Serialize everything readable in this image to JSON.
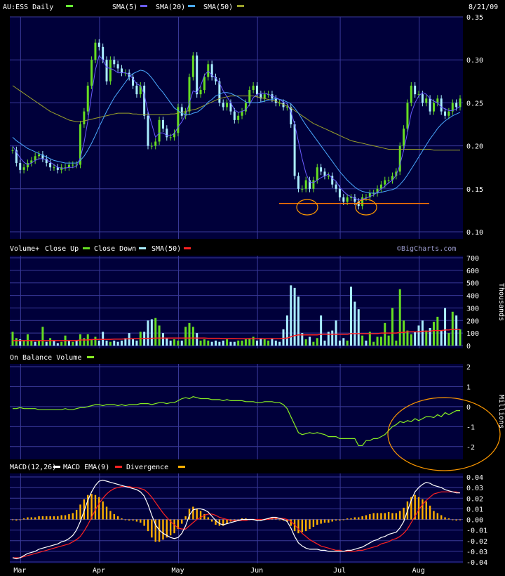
{
  "header": {
    "symbol_label": "AU:ESS Daily",
    "date_label": "8/21/09",
    "legend": [
      {
        "name": "SMA(5)",
        "color": "#6a5cff"
      },
      {
        "name": "SMA(20)",
        "color": "#4aa8ff"
      },
      {
        "name": "SMA(50)",
        "color": "#9aa02a"
      }
    ],
    "symbol_swatch": "#66ff33"
  },
  "volume_header": {
    "label_a": "Volume+",
    "label_b": "Close Up",
    "label_c": "Close Down",
    "label_d": "SMA(50)",
    "watermark": "©BigCharts.com",
    "ylabel": "Thousands"
  },
  "obv_header": {
    "label": "On Balance Volume",
    "ylabel": "Millions"
  },
  "macd_header": {
    "label_a": "MACD(12,26)",
    "label_b": "MACD EMA(9)",
    "label_c": "Divergence"
  },
  "colors": {
    "bg": "#000000",
    "panel": "#00003a",
    "grid": "#3a3a9a",
    "up": "#66dd22",
    "down": "#aaeeff",
    "sma5": "#6a5cff",
    "sma20": "#4aa8ff",
    "sma50": "#9aa02a",
    "volsma": "#ff2222",
    "obv": "#88ee22",
    "macd": "#ffffff",
    "signal": "#ff2222",
    "divergence": "#ffb000",
    "annotation": "#ff7700",
    "circle": "#ff9900"
  },
  "chart_data": [
    {
      "type": "candlestick",
      "title": "AU:ESS Daily",
      "x_month_ticks": [
        "Mar",
        "Apr",
        "May",
        "Jun",
        "Jul",
        "Aug"
      ],
      "ylim": [
        0.1,
        0.35
      ],
      "y_ticks": [
        "0.35",
        "0.30",
        "0.25",
        "0.20",
        "0.15",
        "0.10"
      ],
      "grid": true,
      "support_price": 0.133,
      "close": [
        0.195,
        0.18,
        0.172,
        0.175,
        0.18,
        0.183,
        0.188,
        0.19,
        0.185,
        0.18,
        0.175,
        0.175,
        0.172,
        0.175,
        0.175,
        0.178,
        0.178,
        0.178,
        0.225,
        0.24,
        0.27,
        0.3,
        0.32,
        0.315,
        0.3,
        0.275,
        0.3,
        0.295,
        0.29,
        0.285,
        0.285,
        0.28,
        0.27,
        0.26,
        0.27,
        0.235,
        0.2,
        0.2,
        0.205,
        0.23,
        0.22,
        0.21,
        0.21,
        0.215,
        0.245,
        0.235,
        0.24,
        0.28,
        0.305,
        0.26,
        0.265,
        0.28,
        0.295,
        0.28,
        0.275,
        0.25,
        0.245,
        0.25,
        0.24,
        0.23,
        0.235,
        0.24,
        0.25,
        0.265,
        0.27,
        0.26,
        0.255,
        0.26,
        0.26,
        0.255,
        0.25,
        0.25,
        0.245,
        0.245,
        0.225,
        0.165,
        0.15,
        0.15,
        0.16,
        0.15,
        0.16,
        0.175,
        0.17,
        0.165,
        0.165,
        0.155,
        0.15,
        0.14,
        0.135,
        0.14,
        0.14,
        0.135,
        0.13,
        0.14,
        0.14,
        0.145,
        0.145,
        0.15,
        0.155,
        0.16,
        0.16,
        0.165,
        0.17,
        0.2,
        0.22,
        0.25,
        0.27,
        0.26,
        0.26,
        0.25,
        0.255,
        0.24,
        0.25,
        0.255,
        0.24,
        0.235,
        0.24,
        0.25,
        0.245,
        0.255
      ],
      "sma5": [
        0.2,
        0.193,
        0.186,
        0.181,
        0.178,
        0.18,
        0.183,
        0.185,
        0.185,
        0.184,
        0.181,
        0.178,
        0.175,
        0.174,
        0.174,
        0.175,
        0.175,
        0.176,
        0.186,
        0.204,
        0.229,
        0.26,
        0.288,
        0.305,
        0.3,
        0.291,
        0.29,
        0.288,
        0.285,
        0.285,
        0.285,
        0.283,
        0.278,
        0.272,
        0.27,
        0.26,
        0.24,
        0.225,
        0.21,
        0.215,
        0.215,
        0.212,
        0.212,
        0.214,
        0.222,
        0.228,
        0.236,
        0.25,
        0.264,
        0.262,
        0.27,
        0.282,
        0.287,
        0.282,
        0.279,
        0.273,
        0.264,
        0.257,
        0.25,
        0.242,
        0.239,
        0.24,
        0.242,
        0.248,
        0.256,
        0.26,
        0.261,
        0.261,
        0.26,
        0.258,
        0.256,
        0.254,
        0.251,
        0.249,
        0.24,
        0.225,
        0.205,
        0.185,
        0.168,
        0.158,
        0.157,
        0.16,
        0.163,
        0.165,
        0.167,
        0.162,
        0.159,
        0.152,
        0.147,
        0.143,
        0.141,
        0.139,
        0.137,
        0.138,
        0.139,
        0.141,
        0.143,
        0.146,
        0.15,
        0.153,
        0.157,
        0.16,
        0.166,
        0.178,
        0.195,
        0.215,
        0.238,
        0.25,
        0.258,
        0.262,
        0.26,
        0.255,
        0.252,
        0.25,
        0.245,
        0.243,
        0.241,
        0.241,
        0.243,
        0.246
      ],
      "sma20": [
        0.21,
        0.206,
        0.203,
        0.2,
        0.197,
        0.195,
        0.193,
        0.191,
        0.189,
        0.187,
        0.185,
        0.183,
        0.182,
        0.181,
        0.18,
        0.18,
        0.18,
        0.18,
        0.183,
        0.188,
        0.195,
        0.203,
        0.212,
        0.222,
        0.231,
        0.24,
        0.248,
        0.256,
        0.262,
        0.268,
        0.274,
        0.28,
        0.284,
        0.286,
        0.288,
        0.287,
        0.284,
        0.279,
        0.273,
        0.267,
        0.262,
        0.256,
        0.25,
        0.244,
        0.241,
        0.238,
        0.236,
        0.236,
        0.238,
        0.239,
        0.242,
        0.246,
        0.251,
        0.254,
        0.258,
        0.26,
        0.262,
        0.262,
        0.261,
        0.259,
        0.257,
        0.254,
        0.251,
        0.25,
        0.25,
        0.25,
        0.251,
        0.252,
        0.253,
        0.254,
        0.255,
        0.254,
        0.253,
        0.251,
        0.249,
        0.244,
        0.238,
        0.231,
        0.224,
        0.218,
        0.212,
        0.206,
        0.2,
        0.194,
        0.188,
        0.182,
        0.176,
        0.17,
        0.165,
        0.16,
        0.156,
        0.152,
        0.149,
        0.147,
        0.146,
        0.145,
        0.145,
        0.145,
        0.146,
        0.147,
        0.148,
        0.149,
        0.151,
        0.155,
        0.16,
        0.166,
        0.173,
        0.18,
        0.187,
        0.194,
        0.201,
        0.208,
        0.214,
        0.22,
        0.225,
        0.229,
        0.232,
        0.235,
        0.237,
        0.239
      ],
      "sma50": [
        0.27,
        0.267,
        0.264,
        0.261,
        0.258,
        0.255,
        0.252,
        0.249,
        0.246,
        0.243,
        0.24,
        0.238,
        0.236,
        0.234,
        0.232,
        0.23,
        0.229,
        0.228,
        0.228,
        0.229,
        0.23,
        0.231,
        0.232,
        0.233,
        0.234,
        0.235,
        0.236,
        0.237,
        0.238,
        0.238,
        0.238,
        0.238,
        0.237,
        0.237,
        0.236,
        0.236,
        0.236,
        0.236,
        0.236,
        0.236,
        0.236,
        0.236,
        0.237,
        0.237,
        0.238,
        0.239,
        0.24,
        0.241,
        0.242,
        0.243,
        0.245,
        0.247,
        0.249,
        0.251,
        0.253,
        0.255,
        0.256,
        0.257,
        0.258,
        0.258,
        0.258,
        0.258,
        0.258,
        0.258,
        0.258,
        0.257,
        0.256,
        0.255,
        0.254,
        0.253,
        0.252,
        0.25,
        0.248,
        0.246,
        0.244,
        0.241,
        0.238,
        0.235,
        0.232,
        0.229,
        0.226,
        0.224,
        0.222,
        0.22,
        0.218,
        0.216,
        0.214,
        0.212,
        0.21,
        0.208,
        0.206,
        0.205,
        0.204,
        0.203,
        0.202,
        0.201,
        0.2,
        0.199,
        0.198,
        0.197,
        0.196,
        0.196,
        0.196,
        0.196,
        0.196,
        0.196,
        0.196,
        0.196,
        0.196,
        0.196,
        0.196,
        0.196,
        0.195,
        0.195,
        0.195,
        0.195,
        0.195,
        0.195,
        0.195,
        0.195
      ]
    },
    {
      "type": "bar",
      "title": "Volume",
      "ylabel": "Thousands",
      "ylim": [
        0,
        700
      ],
      "y_ticks": [
        "700",
        "600",
        "500",
        "400",
        "300",
        "200",
        "100",
        "0"
      ],
      "values": [
        110,
        60,
        50,
        40,
        90,
        40,
        30,
        40,
        150,
        30,
        60,
        40,
        20,
        30,
        80,
        40,
        30,
        40,
        90,
        60,
        90,
        50,
        70,
        40,
        110,
        40,
        30,
        40,
        30,
        40,
        60,
        100,
        50,
        40,
        110,
        110,
        200,
        210,
        220,
        160,
        100,
        60,
        40,
        50,
        40,
        40,
        150,
        180,
        150,
        100,
        40,
        50,
        40,
        30,
        40,
        30,
        40,
        50,
        30,
        30,
        40,
        40,
        50,
        60,
        70,
        40,
        60,
        50,
        40,
        60,
        40,
        30,
        130,
        240,
        480,
        460,
        390,
        100,
        50,
        70,
        30,
        60,
        240,
        40,
        110,
        120,
        200,
        40,
        60,
        40,
        470,
        350,
        290,
        80,
        40,
        110,
        30,
        70,
        70,
        180,
        80,
        300,
        40,
        450,
        200,
        120,
        90,
        110,
        160,
        200,
        120,
        140,
        190,
        230,
        120,
        300,
        100,
        270,
        240,
        130
      ],
      "up": [
        true,
        true,
        false,
        true,
        true,
        true,
        false,
        true,
        true,
        false,
        true,
        false,
        false,
        true,
        true,
        false,
        true,
        false,
        true,
        true,
        true,
        true,
        true,
        false,
        false,
        false,
        true,
        false,
        false,
        false,
        false,
        false,
        false,
        false,
        true,
        false,
        false,
        false,
        true,
        true,
        false,
        false,
        false,
        true,
        true,
        false,
        true,
        true,
        true,
        false,
        true,
        true,
        true,
        false,
        false,
        false,
        false,
        true,
        false,
        false,
        true,
        true,
        true,
        true,
        true,
        false,
        false,
        true,
        true,
        false,
        false,
        false,
        false,
        false,
        false,
        false,
        false,
        false,
        true,
        false,
        true,
        true,
        false,
        false,
        false,
        false,
        false,
        false,
        false,
        true,
        false,
        false,
        false,
        true,
        false,
        true,
        true,
        true,
        true,
        true,
        true,
        true,
        true,
        true,
        true,
        true,
        true,
        false,
        false,
        false,
        true,
        false,
        true,
        true,
        false,
        false,
        true,
        true,
        false,
        true
      ],
      "sma50": [
        40,
        40,
        40,
        40,
        40,
        40,
        40,
        40,
        40,
        40,
        40,
        40,
        40,
        40,
        40,
        40,
        40,
        40,
        45,
        45,
        45,
        48,
        48,
        50,
        50,
        50,
        50,
        52,
        52,
        52,
        54,
        54,
        55,
        55,
        56,
        57,
        58,
        58,
        60,
        60,
        60,
        60,
        60,
        60,
        60,
        60,
        60,
        60,
        60,
        60,
        60,
        60,
        58,
        58,
        58,
        58,
        56,
        56,
        56,
        56,
        55,
        55,
        55,
        55,
        55,
        55,
        55,
        55,
        55,
        55,
        55,
        56,
        58,
        60,
        70,
        80,
        85,
        85,
        85,
        85,
        85,
        85,
        90,
        90,
        90,
        90,
        90,
        90,
        90,
        90,
        95,
        95,
        95,
        95,
        95,
        95,
        95,
        95,
        100,
        100,
        100,
        100,
        100,
        105,
        105,
        110,
        110,
        110,
        110,
        115,
        115,
        115,
        120,
        120,
        120,
        125,
        125,
        130,
        130,
        130
      ]
    },
    {
      "type": "line",
      "title": "On Balance Volume",
      "ylabel": "Millions",
      "ylim": [
        -2.5,
        2
      ],
      "y_ticks": [
        "2",
        "1",
        "0",
        "-1",
        "-2"
      ],
      "values": [
        -0.1,
        -0.1,
        -0.05,
        -0.1,
        -0.1,
        -0.1,
        -0.1,
        -0.15,
        -0.15,
        -0.15,
        -0.15,
        -0.15,
        -0.15,
        -0.15,
        -0.1,
        -0.15,
        -0.15,
        -0.1,
        -0.05,
        -0.05,
        0.0,
        0.05,
        0.1,
        0.1,
        0.05,
        0.1,
        0.1,
        0.1,
        0.05,
        0.1,
        0.05,
        0.1,
        0.1,
        0.1,
        0.15,
        0.15,
        0.15,
        0.1,
        0.15,
        0.2,
        0.2,
        0.15,
        0.2,
        0.2,
        0.3,
        0.4,
        0.45,
        0.4,
        0.5,
        0.45,
        0.4,
        0.4,
        0.4,
        0.35,
        0.35,
        0.35,
        0.3,
        0.35,
        0.3,
        0.3,
        0.3,
        0.3,
        0.25,
        0.25,
        0.25,
        0.2,
        0.2,
        0.25,
        0.25,
        0.25,
        0.2,
        0.2,
        0.1,
        -0.1,
        -0.5,
        -0.9,
        -1.3,
        -1.4,
        -1.35,
        -1.3,
        -1.35,
        -1.3,
        -1.35,
        -1.4,
        -1.5,
        -1.5,
        -1.5,
        -1.6,
        -1.6,
        -1.6,
        -1.6,
        -1.6,
        -1.95,
        -1.95,
        -1.7,
        -1.7,
        -1.6,
        -1.6,
        -1.5,
        -1.4,
        -1.2,
        -1.0,
        -0.9,
        -0.75,
        -0.8,
        -0.7,
        -0.75,
        -0.6,
        -0.7,
        -0.6,
        -0.5,
        -0.5,
        -0.55,
        -0.4,
        -0.5,
        -0.3,
        -0.4,
        -0.3,
        -0.2,
        -0.2
      ]
    },
    {
      "type": "line",
      "title": "MACD(12,26)",
      "ylim": [
        -0.04,
        0.04
      ],
      "y_ticks": [
        "0.04",
        "0.03",
        "0.02",
        "0.01",
        "0.00",
        "-0.01",
        "-0.02",
        "-0.03",
        "-0.04"
      ],
      "macd": [
        -0.036,
        -0.037,
        -0.036,
        -0.034,
        -0.032,
        -0.031,
        -0.03,
        -0.028,
        -0.027,
        -0.026,
        -0.025,
        -0.024,
        -0.023,
        -0.021,
        -0.02,
        -0.018,
        -0.015,
        -0.01,
        -0.002,
        0.008,
        0.018,
        0.026,
        0.032,
        0.036,
        0.037,
        0.036,
        0.035,
        0.034,
        0.033,
        0.032,
        0.031,
        0.03,
        0.029,
        0.028,
        0.026,
        0.022,
        0.014,
        0.004,
        -0.005,
        -0.01,
        -0.013,
        -0.015,
        -0.017,
        -0.018,
        -0.017,
        -0.013,
        -0.006,
        0.004,
        0.009,
        0.01,
        0.01,
        0.009,
        0.007,
        0.003,
        -0.001,
        -0.004,
        -0.005,
        -0.004,
        -0.003,
        -0.002,
        -0.001,
        0.0,
        0.0,
        0.0,
        0.0,
        -0.001,
        -0.001,
        0.0,
        0.001,
        0.002,
        0.002,
        0.001,
        0.0,
        -0.002,
        -0.008,
        -0.016,
        -0.022,
        -0.025,
        -0.027,
        -0.028,
        -0.028,
        -0.028,
        -0.029,
        -0.029,
        -0.03,
        -0.03,
        -0.03,
        -0.03,
        -0.03,
        -0.029,
        -0.029,
        -0.028,
        -0.027,
        -0.026,
        -0.024,
        -0.022,
        -0.02,
        -0.019,
        -0.017,
        -0.016,
        -0.014,
        -0.013,
        -0.012,
        -0.008,
        -0.002,
        0.008,
        0.018,
        0.026,
        0.03,
        0.033,
        0.035,
        0.034,
        0.032,
        0.031,
        0.03,
        0.028,
        0.027,
        0.026,
        0.025,
        0.025
      ],
      "signal": [
        -0.036,
        -0.036,
        -0.036,
        -0.035,
        -0.034,
        -0.033,
        -0.032,
        -0.031,
        -0.03,
        -0.029,
        -0.028,
        -0.027,
        -0.026,
        -0.025,
        -0.024,
        -0.023,
        -0.021,
        -0.019,
        -0.016,
        -0.011,
        -0.005,
        0.002,
        0.009,
        0.015,
        0.02,
        0.024,
        0.027,
        0.029,
        0.03,
        0.031,
        0.031,
        0.031,
        0.03,
        0.03,
        0.029,
        0.028,
        0.025,
        0.021,
        0.016,
        0.011,
        0.006,
        0.002,
        -0.002,
        -0.005,
        -0.008,
        -0.009,
        -0.009,
        -0.006,
        -0.003,
        0.0,
        0.002,
        0.004,
        0.005,
        0.005,
        0.004,
        0.002,
        0.001,
        0.0,
        -0.001,
        -0.001,
        -0.001,
        -0.001,
        -0.001,
        0.0,
        0.0,
        0.0,
        0.0,
        0.0,
        0.0,
        0.001,
        0.001,
        0.001,
        0.001,
        0.0,
        -0.002,
        -0.005,
        -0.009,
        -0.013,
        -0.016,
        -0.019,
        -0.021,
        -0.023,
        -0.025,
        -0.026,
        -0.027,
        -0.028,
        -0.029,
        -0.029,
        -0.03,
        -0.03,
        -0.03,
        -0.03,
        -0.029,
        -0.029,
        -0.028,
        -0.027,
        -0.026,
        -0.025,
        -0.023,
        -0.022,
        -0.021,
        -0.019,
        -0.018,
        -0.016,
        -0.013,
        -0.009,
        -0.003,
        0.003,
        0.009,
        0.014,
        0.018,
        0.021,
        0.024,
        0.025,
        0.026,
        0.026,
        0.026,
        0.026,
        0.026,
        0.025
      ]
    }
  ]
}
